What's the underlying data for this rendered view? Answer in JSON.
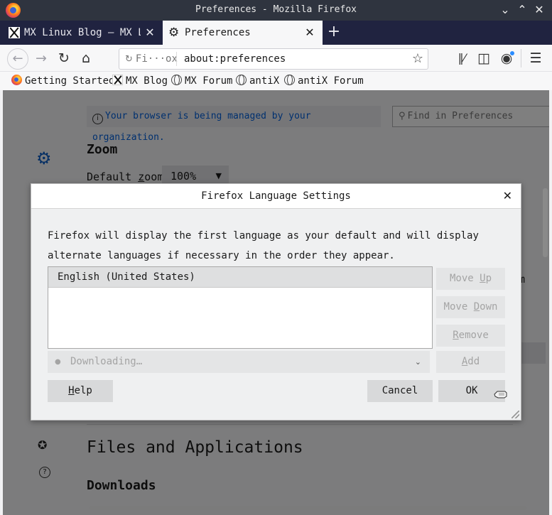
{
  "window": {
    "title": "Preferences - Mozilla Firefox",
    "controls": [
      "minimize",
      "maximize",
      "close"
    ]
  },
  "tabs": [
    {
      "label": "MX Linux Blog – MX Linux",
      "active": false
    },
    {
      "label": "Preferences",
      "active": true
    }
  ],
  "navbar": {
    "identity_label": "Fi···ox",
    "url": "about:preferences"
  },
  "bookmarks": [
    {
      "label": "Getting Started",
      "icon": "firefox-icon"
    },
    {
      "label": "MX Blog",
      "icon": "mx-logo-icon"
    },
    {
      "label": "MX Forum",
      "icon": "globe-icon"
    },
    {
      "label": "antiX",
      "icon": "globe-icon"
    },
    {
      "label": "antiX Forum",
      "icon": "globe-icon"
    }
  ],
  "content": {
    "policy_notice": "Your browser is being managed by your organization.",
    "find_placeholder": "Find in Preferences",
    "zoom_heading": "Zoom",
    "default_zoom_label": "Default zoom",
    "default_zoom_value": "100%",
    "peek_text": "m",
    "files_heading": "Files and Applications",
    "downloads_heading": "Downloads"
  },
  "dialog": {
    "title": "Firefox Language Settings",
    "description": "Firefox will display the first language as your default and will display alternate languages if necessary in the order they appear.",
    "languages": [
      "English (United States)"
    ],
    "buttons": {
      "move_up": "Move Up",
      "move_down": "Move Down",
      "remove": "Remove",
      "add": "Add",
      "help": "Help",
      "cancel": "Cancel",
      "ok": "OK"
    },
    "language_select": "Downloading…"
  }
}
